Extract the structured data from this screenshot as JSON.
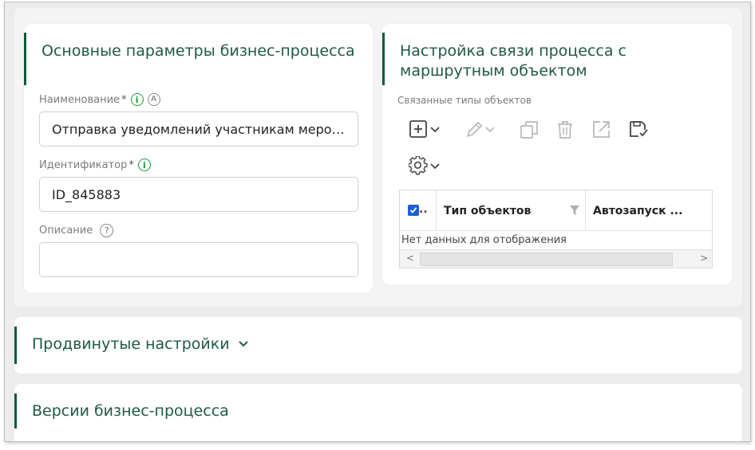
{
  "basic": {
    "title": "Основные параметры бизнес-процесса",
    "name_label": "Наименование",
    "name_required": "*",
    "name_auto_letter": "A",
    "name_value": "Отправка уведомлений участникам мероприятия",
    "id_label": "Идентификатор",
    "id_required": "*",
    "id_value": "ID_845883",
    "desc_label": "Описание",
    "desc_value": ""
  },
  "route": {
    "title": "Настройка связи процесса с маршрутным объектом",
    "linked_types_label": "Связанные типы объектов",
    "toolbar": [
      "add-icon",
      "edit-icon",
      "copy-icon",
      "delete-icon",
      "export-icon",
      "save-icon",
      "settings-icon"
    ],
    "grid": {
      "columns": [
        "Тип объектов",
        "Автозапуск ..."
      ],
      "empty_text": "Нет данных для отображения"
    }
  },
  "advanced": {
    "title": "Продвинутые настройки"
  },
  "versions": {
    "title": "Версии бизнес-процесса"
  },
  "colors": {
    "accent": "#0b5a3a",
    "title": "#1f5a42",
    "info": "#1a9a36",
    "checkbox": "#1a5fd6"
  }
}
